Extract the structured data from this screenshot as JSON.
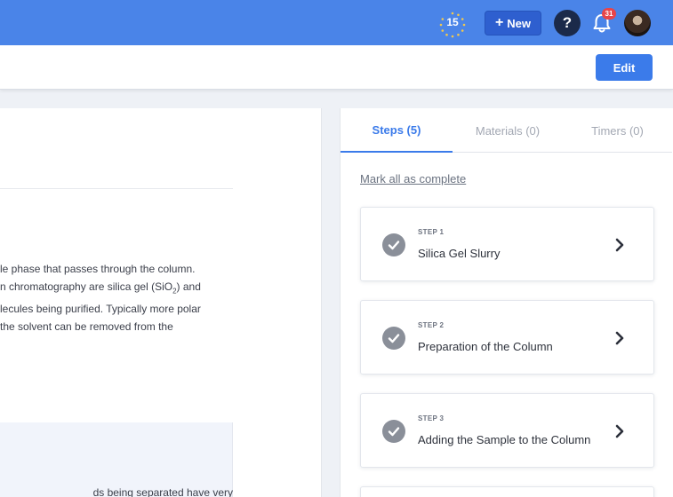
{
  "header": {
    "timer_count": "15",
    "new_button": {
      "icon": "plus-icon",
      "label": "New"
    },
    "help": {
      "icon": "question-icon",
      "label": "?"
    },
    "notifications": {
      "icon": "bell-icon",
      "count": "31"
    },
    "avatar": "user-avatar"
  },
  "toolbar": {
    "edit_label": "Edit"
  },
  "content": {
    "paragraph_lines": [
      "le phase that passes through the column.",
      "n chromatography are silica gel (SiO",
      "lecules being purified. Typically more polar",
      " the solvent can be removed from the"
    ],
    "paragraph_line2_sub": "2",
    "paragraph_line2_tail": ") and",
    "note_partial": "ds being separated have very"
  },
  "panel": {
    "tabs": [
      {
        "label": "Steps (5)",
        "active": true
      },
      {
        "label": "Materials (0)",
        "active": false
      },
      {
        "label": "Timers (0)",
        "active": false
      }
    ],
    "mark_all_label": "Mark all as complete",
    "steps": [
      {
        "number_label": "STEP 1",
        "title": "Silica Gel Slurry",
        "completed": true
      },
      {
        "number_label": "STEP 2",
        "title": "Preparation of the Column",
        "completed": true
      },
      {
        "number_label": "STEP 3",
        "title": "Adding the Sample to the Column",
        "completed": true
      }
    ]
  },
  "colors": {
    "brand_blue": "#4a84e8",
    "button_dark_blue": "#2e5fcf",
    "accent_blue": "#3b7bea",
    "badge_red": "#e8454a",
    "check_gray": "#8a8f99"
  }
}
